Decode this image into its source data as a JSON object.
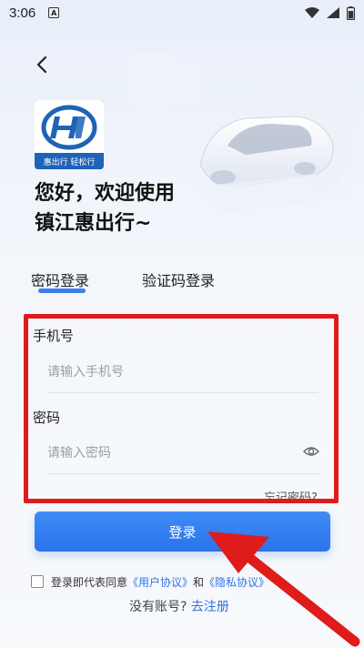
{
  "status_bar": {
    "time": "3:06",
    "app_indicator": "A",
    "icons": [
      "wifi-icon",
      "signal-icon",
      "battery-icon"
    ]
  },
  "header": {
    "back_icon": "chevron-left-icon"
  },
  "logo": {
    "caption": "惠出行 轻松行"
  },
  "welcome": {
    "line1": "您好，欢迎使用",
    "line2": "镇江惠出行~"
  },
  "tabs": {
    "items": [
      {
        "label": "密码登录",
        "active": true
      },
      {
        "label": "验证码登录",
        "active": false
      }
    ]
  },
  "form": {
    "phone": {
      "label": "手机号",
      "placeholder": "请输入手机号",
      "value": ""
    },
    "password": {
      "label": "密码",
      "placeholder": "请输入密码",
      "value": ""
    },
    "forgot_label": "忘记密码?",
    "submit_label": "登录"
  },
  "agreement": {
    "prefix": "登录即代表同意",
    "user_agreement": "《用户协议》",
    "and": "和",
    "privacy": "《隐私协议》",
    "checked": false
  },
  "register": {
    "prompt": "没有账号?",
    "link": "去注册"
  },
  "colors": {
    "accent": "#2f72e6",
    "button": "#3b7ff0",
    "annotation": "#e01b1b"
  }
}
